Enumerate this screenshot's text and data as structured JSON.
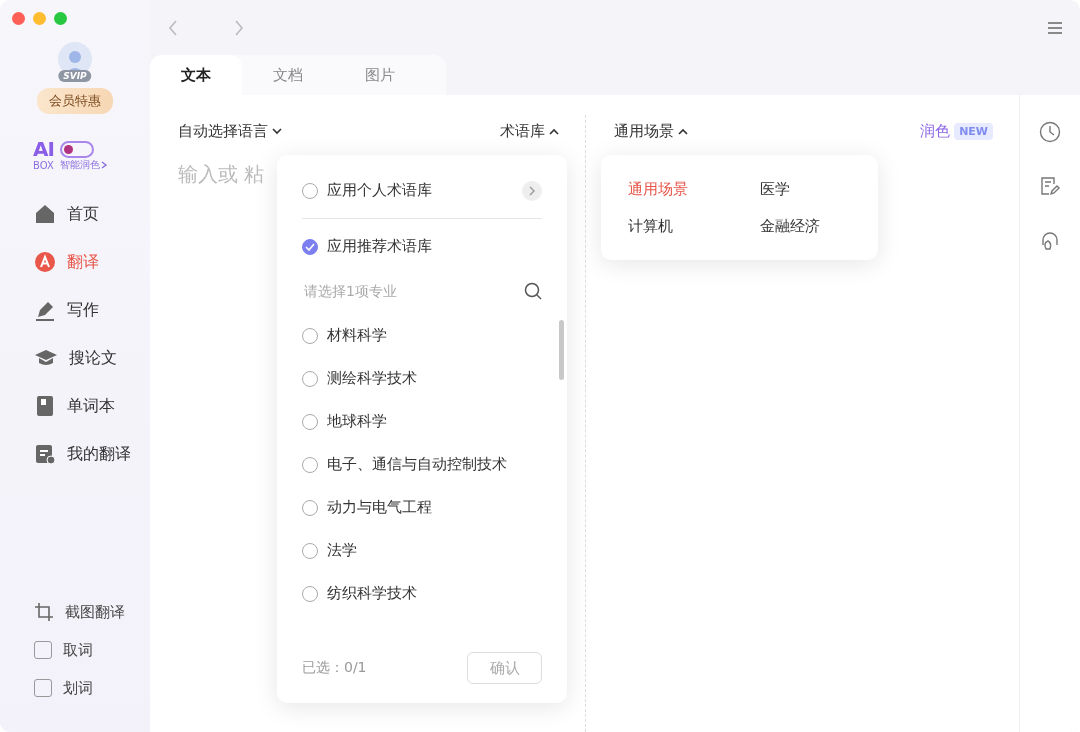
{
  "sidebar": {
    "badge": "SVIP",
    "vip_button": "会员特惠",
    "ai_box": {
      "logo": "AI",
      "sub": "BOX",
      "label": "智能润色",
      "on": false
    },
    "nav": [
      {
        "kind": "home",
        "label": "首页",
        "selected": false
      },
      {
        "kind": "translate",
        "label": "翻译",
        "selected": true
      },
      {
        "kind": "write",
        "label": "写作",
        "selected": false
      },
      {
        "kind": "paper",
        "label": "搜论文",
        "selected": false
      },
      {
        "kind": "book",
        "label": "单词本",
        "selected": false
      },
      {
        "kind": "mine",
        "label": "我的翻译",
        "selected": false
      }
    ],
    "tools": [
      {
        "kind": "crop",
        "label": "截图翻译"
      },
      {
        "kind": "checkbox",
        "label": "取词",
        "checked": false
      },
      {
        "kind": "checkbox",
        "label": "划词",
        "checked": false
      }
    ]
  },
  "tabs": [
    {
      "label": "文本",
      "selected": true
    },
    {
      "label": "文档",
      "selected": false
    },
    {
      "label": "图片",
      "selected": false
    }
  ],
  "source": {
    "language": "自动选择语言",
    "termbase": "术语库",
    "termbase_expanded": true,
    "placeholder": "输入或 粘"
  },
  "target": {
    "scene": "通用场景",
    "scene_expanded": true,
    "polish": "润色",
    "badge": "NEW"
  },
  "term_menu": {
    "options": [
      {
        "label": "应用个人术语库",
        "checked": false
      },
      {
        "label": "应用推荐术语库",
        "checked": true
      }
    ],
    "search_placeholder": "请选择1项专业",
    "fields": [
      {
        "label": "材料科学",
        "selected": false
      },
      {
        "label": "测绘科学技术",
        "selected": false
      },
      {
        "label": "地球科学",
        "selected": false
      },
      {
        "label": "电子、通信与自动控制技术",
        "selected": false
      },
      {
        "label": "动力与电气工程",
        "selected": false
      },
      {
        "label": "法学",
        "selected": false
      },
      {
        "label": "纺织科学技术",
        "selected": false
      }
    ],
    "count": "已选：0/1",
    "confirm": "确认",
    "confirm_disabled": true
  },
  "scene_menu": [
    {
      "label": "通用场景",
      "selected": true
    },
    {
      "label": "医学",
      "selected": false
    },
    {
      "label": "计算机",
      "selected": false
    },
    {
      "label": "金融经济",
      "selected": false
    }
  ]
}
